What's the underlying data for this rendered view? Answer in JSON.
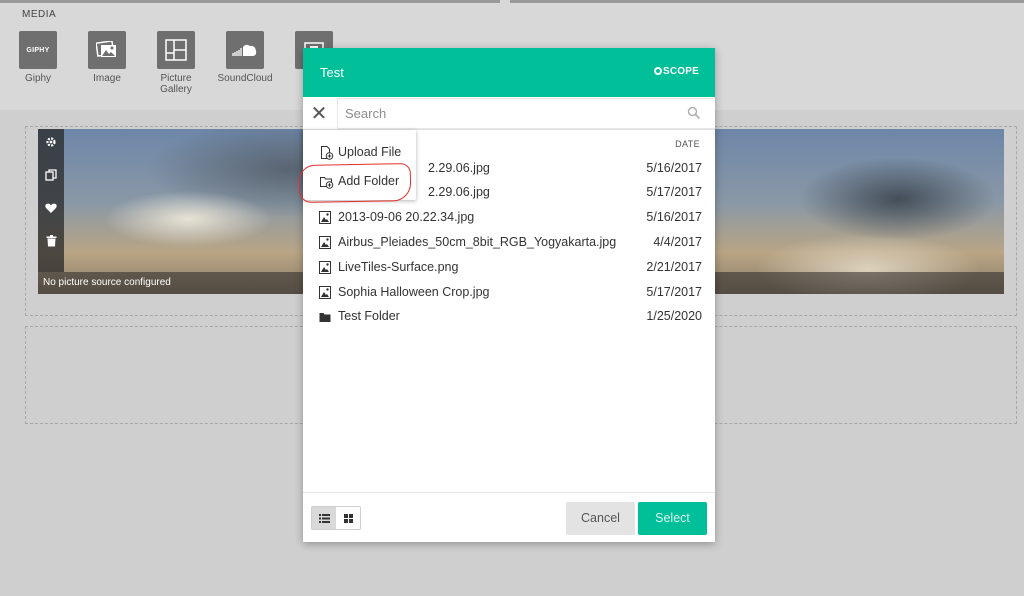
{
  "media_bar": {
    "title": "MEDIA",
    "items": [
      {
        "label": "Giphy",
        "tile_text": "GIPHY",
        "icon": "giphy-icon"
      },
      {
        "label": "Image",
        "icon": "image-icon"
      },
      {
        "label": "Picture Gallery",
        "icon": "gallery-icon"
      },
      {
        "label": "SoundCloud",
        "icon": "soundcloud-icon"
      },
      {
        "label": "",
        "icon": "video-icon"
      }
    ]
  },
  "hero": {
    "caption": "No picture source configured",
    "tools": [
      "gear-icon",
      "copy-icon",
      "heart-icon",
      "trash-icon"
    ]
  },
  "dialog": {
    "title": "Test",
    "brand": "SCOPE",
    "search_placeholder": "Search",
    "date_header": "DATE",
    "files": [
      {
        "name": "2.29.06.jpg",
        "date": "5/16/2017",
        "type": "image"
      },
      {
        "name": "2.29.06.jpg",
        "date": "5/17/2017",
        "type": "image"
      },
      {
        "name": "2013-09-06 20.22.34.jpg",
        "date": "5/16/2017",
        "type": "image"
      },
      {
        "name": "Airbus_Pleiades_50cm_8bit_RGB_Yogyakarta.jpg",
        "date": "4/4/2017",
        "type": "image"
      },
      {
        "name": "LiveTiles-Surface.png",
        "date": "2/21/2017",
        "type": "image"
      },
      {
        "name": "Sophia Halloween Crop.jpg",
        "date": "5/17/2017",
        "type": "image"
      },
      {
        "name": "Test Folder",
        "date": "1/25/2020",
        "type": "folder"
      }
    ],
    "menu": {
      "upload_label": "Upload File",
      "add_folder_label": "Add Folder"
    },
    "footer": {
      "cancel_label": "Cancel",
      "select_label": "Select"
    }
  },
  "colors": {
    "accent": "#00bf99",
    "annotation": "#e0312b"
  }
}
